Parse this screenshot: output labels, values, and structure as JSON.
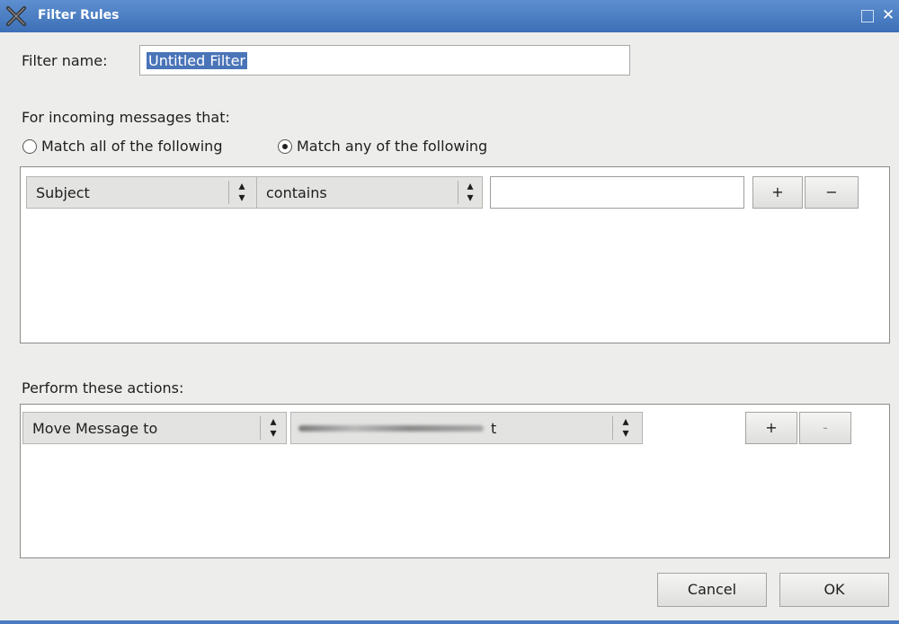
{
  "window": {
    "title": "Filter Rules",
    "maximize_icon": "maximize-icon",
    "close_icon": "close-icon",
    "app_icon": "x-icon"
  },
  "filter_name": {
    "label": "Filter name:",
    "value": "Untitled Filter"
  },
  "incoming": {
    "heading": "For incoming messages that:",
    "match_all_label": "Match all of the following",
    "match_any_label": "Match any of the following",
    "selected": "any"
  },
  "rule": {
    "field": "Subject",
    "operator": "contains",
    "value": "",
    "add_label": "+",
    "remove_label": "−"
  },
  "actions": {
    "heading": "Perform these actions:",
    "action": "Move Message to",
    "target_visible_suffix": "t",
    "add_label": "+",
    "remove_label": "-"
  },
  "buttons": {
    "cancel": "Cancel",
    "ok": "OK"
  }
}
